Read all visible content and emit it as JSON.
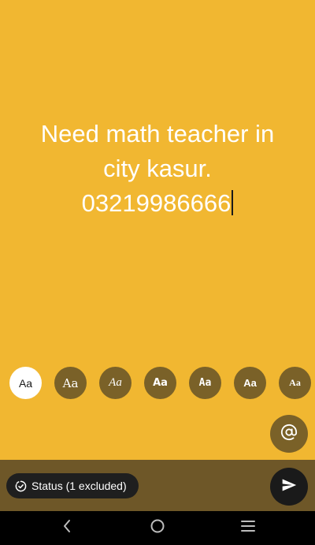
{
  "status_editor": {
    "text_lines": [
      "Need math teacher in",
      "city kasur.",
      "03219986666"
    ],
    "background_color": "#F1B731",
    "text_color": "#FFFFFF"
  },
  "font_options": [
    {
      "label": "Aa",
      "selected": true
    },
    {
      "label": "Aa",
      "selected": false
    },
    {
      "label": "Aa",
      "selected": false
    },
    {
      "label": "Aa",
      "selected": false
    },
    {
      "label": "Aa",
      "selected": false
    },
    {
      "label": "Aa",
      "selected": false
    },
    {
      "label": "Aa",
      "selected": false
    }
  ],
  "mention_button": {
    "icon": "at-sign-icon"
  },
  "bottom_bar": {
    "status_chip_label": "Status (1 excluded)",
    "status_chip_icon": "status-ring-icon",
    "send_icon": "send-icon"
  },
  "nav_bar": {
    "icons": [
      "back-icon",
      "home-icon",
      "recents-icon"
    ]
  }
}
